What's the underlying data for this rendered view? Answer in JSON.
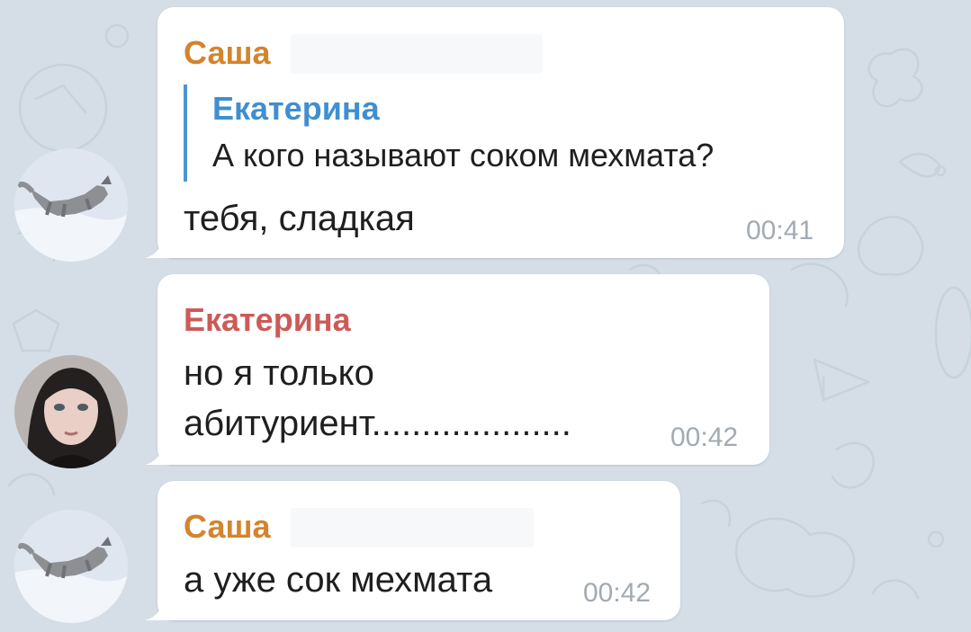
{
  "chat": {
    "messages": [
      {
        "sender": "Саша",
        "sender_color": "#d4842d",
        "reply": {
          "name": "Екатерина",
          "text": "А кого называют соком мехмата?"
        },
        "text": "тебя, сладкая",
        "time": "00:41",
        "avatar": "wolf-in-snow"
      },
      {
        "sender": "Екатерина",
        "sender_color": "#cd5a57",
        "text_lines": [
          "но я только",
          "абитуриент...................."
        ],
        "time": "00:42",
        "avatar": "woman-portrait"
      },
      {
        "sender": "Саша",
        "sender_color": "#d4842d",
        "text": "а уже сок мехмата",
        "time": "00:42",
        "avatar": "wolf-in-snow"
      }
    ]
  },
  "colors": {
    "background": "#d5dee6",
    "bubble": "#ffffff",
    "reply_accent": "#4a96d0",
    "timestamp": "#a2aab2"
  }
}
